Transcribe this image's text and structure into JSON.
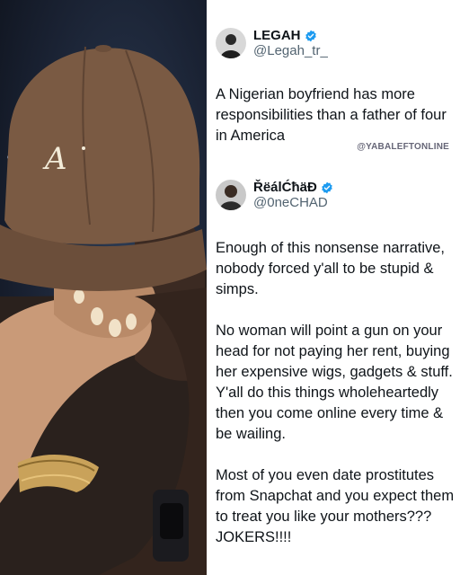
{
  "colors": {
    "verified": "#1d9bf0",
    "cap": "#7a5a43",
    "text": "#0f1419",
    "muted": "#536471"
  },
  "tweet1": {
    "display_name": "LEGAH",
    "handle": "@Legah_tr_",
    "text": "A Nigerian boyfriend has more responsibilities than a father of four in America",
    "verified_icon": "verified-badge-icon"
  },
  "watermark": "@YABALEFTONLINE",
  "tweet2": {
    "display_name": "ŘëálĆħäĐ",
    "handle": "@0neCHAD",
    "paragraphs": [
      "Enough of this nonsense narrative, nobody forced y'all to be stupid & simps.",
      "No woman will point a gun on your head for not paying her rent, buying her expensive wigs, gadgets & stuff. Y'all do this things wholeheartedly then you come online every time & be wailing.",
      "Most of you even date prostitutes from Snapchat and you expect them to treat you like your mothers??? JOKERS!!!!"
    ],
    "verified_icon": "verified-badge-icon"
  },
  "photo": {
    "cap_logo": "A"
  }
}
